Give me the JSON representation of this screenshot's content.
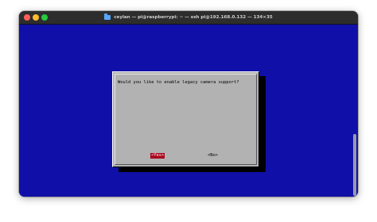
{
  "window": {
    "title": "ceylan — pi@raspberrypi: ~ — ssh pi@192.168.0.132 — 134×35"
  },
  "dialog": {
    "question": "Would you like to enable legacy camera support?",
    "yes_label": "<Yes>",
    "no_label": "<No>"
  },
  "colors": {
    "terminal_bg": "#1010a8",
    "dialog_bg": "#b2b2b2",
    "selected_button": "#a8001a"
  },
  "icons": [
    "folder-icon"
  ]
}
